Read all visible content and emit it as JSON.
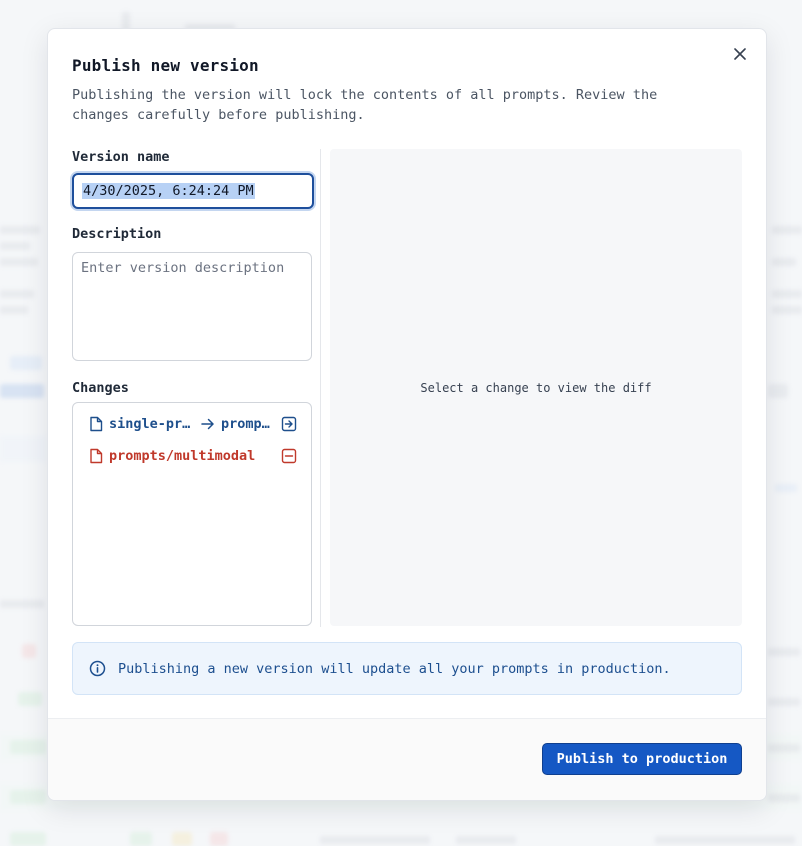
{
  "modal": {
    "title": "Publish new version",
    "subtitle": "Publishing the version will lock the contents of all prompts. Review the changes carefully before publishing.",
    "close_icon": "close-icon"
  },
  "form": {
    "version_label": "Version name",
    "version_value": "4/30/2025, 6:24:24 PM",
    "description_label": "Description",
    "description_placeholder": "Enter version description",
    "description_value": "",
    "changes_label": "Changes"
  },
  "changes": [
    {
      "type": "renamed",
      "from": "single-prompt",
      "to": "prompts",
      "icon": "file-icon",
      "state_icon": "rename-icon",
      "color": "#1e4f8c"
    },
    {
      "type": "deleted",
      "path": "prompts/multimodal",
      "icon": "file-icon",
      "state_icon": "deleted-icon",
      "color": "#c0392b"
    }
  ],
  "diff": {
    "empty_hint": "Select a change to view the diff"
  },
  "banner": {
    "icon": "info-icon",
    "text": "Publishing a new version will update all your prompts in production."
  },
  "footer": {
    "publish_label": "Publish to production"
  },
  "colors": {
    "accent": "#1558c4",
    "danger": "#c0392b",
    "info_bg": "#eef5fd"
  }
}
